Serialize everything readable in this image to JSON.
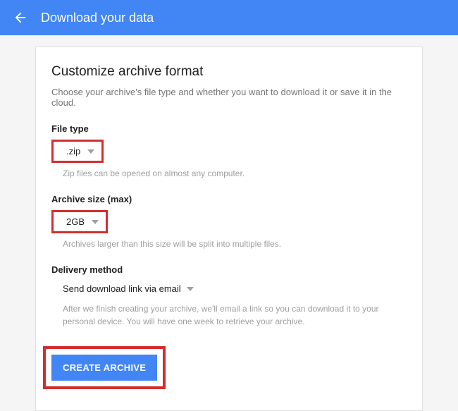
{
  "header": {
    "title": "Download your data"
  },
  "section": {
    "title": "Customize archive format",
    "description": "Choose your archive's file type and whether you want to download it or save it in the cloud."
  },
  "file_type": {
    "label": "File type",
    "value": ".zip",
    "hint": "Zip files can be opened on almost any computer."
  },
  "archive_size": {
    "label": "Archive size (max)",
    "value": "2GB",
    "hint": "Archives larger than this size will be split into multiple files."
  },
  "delivery": {
    "label": "Delivery method",
    "value": "Send download link via email",
    "hint": "After we finish creating your archive, we'll email a link so you can download it to your personal device. You will have one week to retrieve your archive."
  },
  "actions": {
    "create_label": "CREATE ARCHIVE"
  }
}
